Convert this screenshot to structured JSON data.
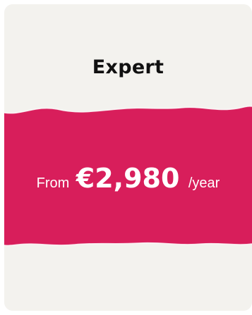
{
  "plan": {
    "name": "Expert",
    "price_prefix": "From",
    "price": "€2,980",
    "period": "/year"
  },
  "colors": {
    "card_background": "#f3f2ee",
    "accent": "#d81e5b",
    "title_text": "#111111",
    "price_text": "#ffffff"
  }
}
